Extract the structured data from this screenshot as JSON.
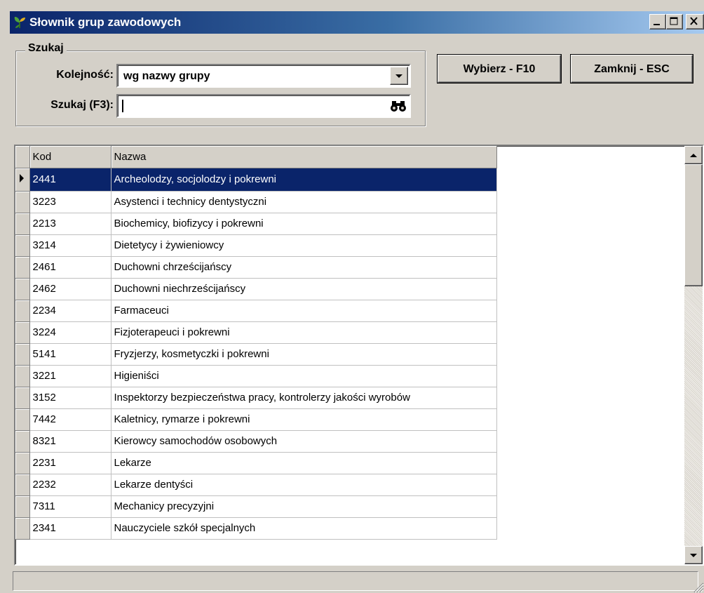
{
  "window": {
    "title": "Słownik grup zawodowych",
    "app_icon": "app-leaf-icon",
    "controls": [
      "minimize-icon",
      "maximize-icon",
      "close-icon"
    ]
  },
  "search_group": {
    "title": "Szukaj",
    "order_label": "Kolejność:",
    "order_value": "wg nazwy grupy",
    "search_label": "Szukaj (F3):",
    "search_value": "",
    "search_icon": "binoculars-icon"
  },
  "buttons": {
    "select": "Wybierz - F10",
    "close": "Zamknij - ESC"
  },
  "grid": {
    "columns": [
      "Kod",
      "Nazwa"
    ],
    "selected_row": 0,
    "rows": [
      {
        "kod": "2441",
        "nazwa": "Archeolodzy, socjolodzy i pokrewni"
      },
      {
        "kod": "3223",
        "nazwa": "Asystenci i technicy dentystyczni"
      },
      {
        "kod": "2213",
        "nazwa": "Biochemicy, biofizycy i pokrewni"
      },
      {
        "kod": "3214",
        "nazwa": "Dietetycy i żywieniowcy"
      },
      {
        "kod": "2461",
        "nazwa": "Duchowni chrześcijańscy"
      },
      {
        "kod": "2462",
        "nazwa": "Duchowni niechrześcijańscy"
      },
      {
        "kod": "2234",
        "nazwa": "Farmaceuci"
      },
      {
        "kod": "3224",
        "nazwa": "Fizjoterapeuci i pokrewni"
      },
      {
        "kod": "5141",
        "nazwa": "Fryzjerzy, kosmetyczki i pokrewni"
      },
      {
        "kod": "3221",
        "nazwa": "Higieniści"
      },
      {
        "kod": "3152",
        "nazwa": "Inspektorzy bezpieczeństwa pracy, kontrolerzy jakości wyrobów"
      },
      {
        "kod": "7442",
        "nazwa": "Kaletnicy, rymarze i pokrewni"
      },
      {
        "kod": "8321",
        "nazwa": "Kierowcy samochodów osobowych"
      },
      {
        "kod": "2231",
        "nazwa": "Lekarze"
      },
      {
        "kod": "2232",
        "nazwa": "Lekarze dentyści"
      },
      {
        "kod": "7311",
        "nazwa": "Mechanicy precyzyjni"
      },
      {
        "kod": "2341",
        "nazwa": "Nauczyciele szkół specjalnych"
      }
    ]
  },
  "colors": {
    "selection": "#0a246a",
    "face": "#d4d0c8",
    "title_start": "#0a246a",
    "title_end": "#a6caf0"
  },
  "statusbar": {
    "text": ""
  }
}
